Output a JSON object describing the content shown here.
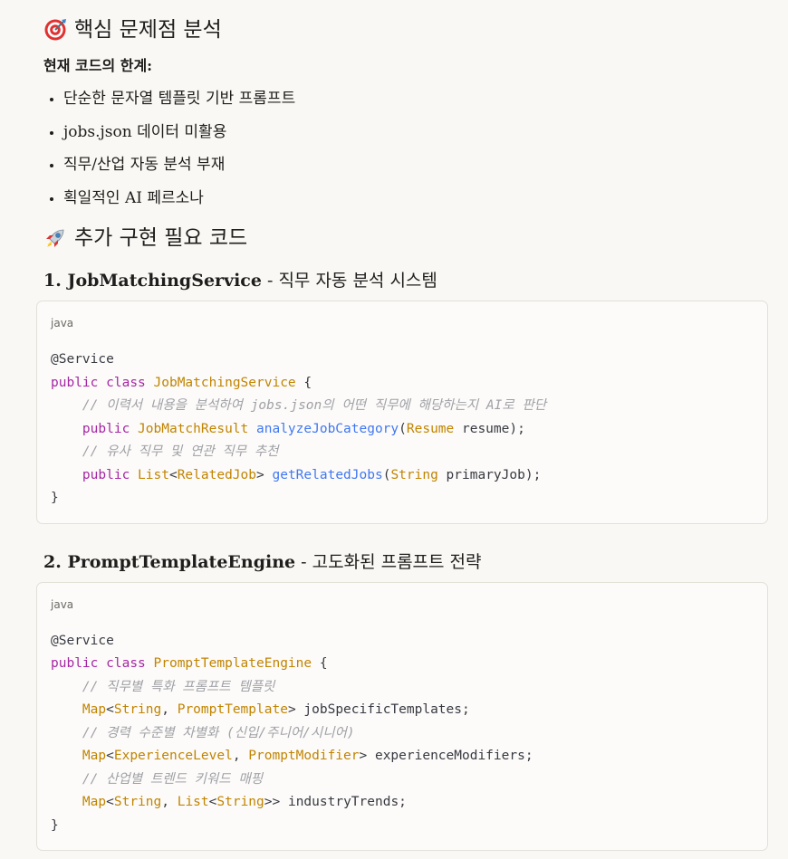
{
  "section1": {
    "title": "핵심 문제점 분석",
    "icon": "target-icon",
    "subheading": "현재 코드의 한계:",
    "bullets": [
      "단순한 문자열 템플릿 기반 프롬프트",
      "jobs.json 데이터 미활용",
      "직무/산업 자동 분석 부재",
      "획일적인 AI 페르소나"
    ]
  },
  "section2": {
    "title": "추가 구현 필요 코드",
    "icon": "rocket-icon"
  },
  "item1": {
    "number_name": "1. JobMatchingService",
    "description": " - 직무 자동 분석 시스템",
    "code": {
      "language": "java",
      "annotation": "@Service",
      "kw_public": "public",
      "kw_class": "class",
      "class_name": "JobMatchingService",
      "open_brace": " {",
      "comment1": "// 이력서 내용을 분석하여 jobs.json의 어떤 직무에 해당하는지 AI로 판단",
      "ret_type1": "JobMatchResult",
      "method1": "analyzeJobCategory",
      "param_type1": "Resume",
      "param_name1": " resume);",
      "comment2": "// 유사 직무 및 연관 직무 추천",
      "ret_type2_outer": "List",
      "ret_type2_inner": "RelatedJob",
      "method2": "getRelatedJobs",
      "param_type2": "String",
      "param_name2": " primaryJob);",
      "close_brace": "}"
    }
  },
  "item2": {
    "number_name": "2. PromptTemplateEngine",
    "description": " - 고도화된 프롬프트 전략",
    "code": {
      "language": "java",
      "annotation": "@Service",
      "kw_public": "public",
      "kw_class": "class",
      "class_name": "PromptTemplateEngine",
      "open_brace": " {",
      "comment1": "// 직무별 특화 프롬프트 템플릿",
      "map": "Map",
      "string": "String",
      "prompt_template": "PromptTemplate",
      "field1": " jobSpecificTemplates;",
      "comment2": "// 경력 수준별 차별화 (신입/주니어/시니어)",
      "experience_level": "ExperienceLevel",
      "prompt_modifier": "PromptModifier",
      "field2": " experienceModifiers;",
      "comment3": "// 산업별 트렌드 키워드 매핑",
      "list": "List",
      "field3": " industryTrends;",
      "close_brace": "}"
    }
  }
}
